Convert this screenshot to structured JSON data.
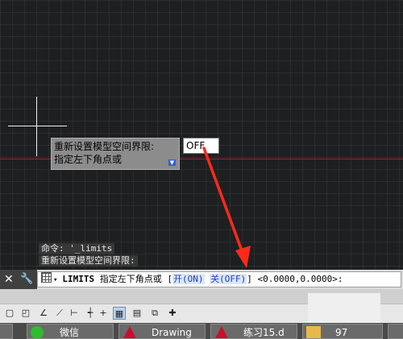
{
  "drawing": {
    "tooltip_line1": "重新设置模型空间界限:",
    "tooltip_line2": "指定左下角点或",
    "tooltip_icon": "down-arrow-icon",
    "input_value": "OFF"
  },
  "history": {
    "line1": "命令: '_limits",
    "line2": "重新设置模型空间界限:"
  },
  "command_line": {
    "command": "LIMITS",
    "prompt": "指定左下角点或",
    "bracket_open": "[",
    "opt_on": "开(ON)",
    "opt_off": "关(OFF)",
    "bracket_close": "]",
    "default_value": "<0.0000,0.0000>:",
    "close_icon": "close-icon",
    "settings_icon": "wrench-icon"
  },
  "taskbar": {
    "items": [
      {
        "label": "微信",
        "icon": "wechat-icon"
      },
      {
        "label": "Drawing",
        "icon": "autocad-icon"
      },
      {
        "label": "练习15.d",
        "icon": "autocad-icon"
      },
      {
        "label": "97",
        "icon": "folder-icon"
      }
    ]
  },
  "colors": {
    "canvas": "#1e1f21",
    "annotation_arrow": "#ff2a1a",
    "option_highlight": "#1a3fbf"
  }
}
